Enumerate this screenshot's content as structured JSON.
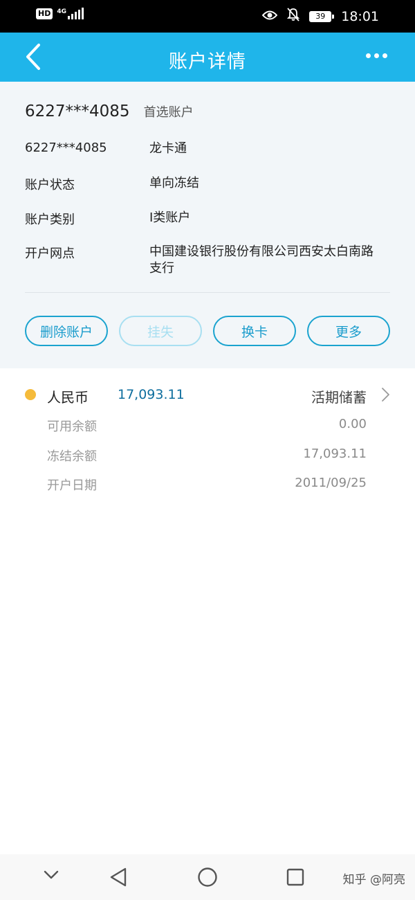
{
  "status_bar": {
    "hd": "HD",
    "network": "4G",
    "network_sub": "1",
    "battery": "39",
    "time": "18:01"
  },
  "header": {
    "title": "账户详情"
  },
  "account": {
    "number": "6227***4085",
    "tag": "首选账户",
    "rows": [
      {
        "label": "6227***4085",
        "value": "龙卡通"
      },
      {
        "label": "账户状态",
        "value": "单向冻结"
      },
      {
        "label": "账户类别",
        "value": "I类账户"
      },
      {
        "label": "开户网点",
        "value": "中国建设银行股份有限公司西安太白南路支行"
      }
    ],
    "buttons": [
      {
        "label": "删除账户",
        "enabled": true
      },
      {
        "label": "挂失",
        "enabled": false
      },
      {
        "label": "换卡",
        "enabled": true
      },
      {
        "label": "更多",
        "enabled": true
      }
    ]
  },
  "balance": {
    "currency": "人民币",
    "amount": "17,093.11",
    "product": "活期储蓄",
    "rows": [
      {
        "label": "可用余额",
        "value": "0.00"
      },
      {
        "label": "冻结余额",
        "value": "17,093.11"
      },
      {
        "label": "开户日期",
        "value": "2011/09/25"
      }
    ]
  },
  "watermark": "知乎 @阿亮",
  "colors": {
    "accent": "#1fb5ea",
    "button_border": "#1aa3cf",
    "currency_dot": "#f5bb3b"
  }
}
